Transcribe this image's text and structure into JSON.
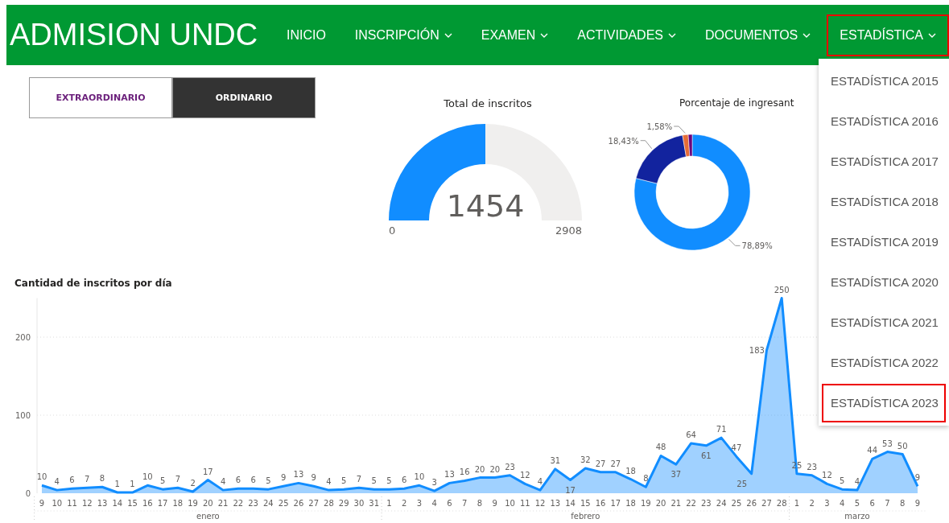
{
  "navbar": {
    "brand": "ADMISION UNDC",
    "items": [
      {
        "label": "INICIO",
        "has_menu": false,
        "highlighted": false
      },
      {
        "label": "INSCRIPCIÓN",
        "has_menu": true,
        "highlighted": false
      },
      {
        "label": "EXAMEN",
        "has_menu": true,
        "highlighted": false
      },
      {
        "label": "ACTIVIDADES",
        "has_menu": true,
        "highlighted": false
      },
      {
        "label": "DOCUMENTOS",
        "has_menu": true,
        "highlighted": false
      },
      {
        "label": "ESTADÍSTICA",
        "has_menu": true,
        "highlighted": true
      }
    ]
  },
  "dropdown": {
    "items": [
      {
        "label": "ESTADÍSTICA 2015",
        "highlighted": false
      },
      {
        "label": "ESTADÍSTICA 2016",
        "highlighted": false
      },
      {
        "label": "ESTADÍSTICA 2017",
        "highlighted": false
      },
      {
        "label": "ESTADÍSTICA 2018",
        "highlighted": false
      },
      {
        "label": "ESTADÍSTICA 2019",
        "highlighted": false
      },
      {
        "label": "ESTADÍSTICA 2020",
        "highlighted": false
      },
      {
        "label": "ESTADÍSTICA 2021",
        "highlighted": false
      },
      {
        "label": "ESTADÍSTICA 2022",
        "highlighted": false
      },
      {
        "label": "ESTADÍSTICA 2023",
        "highlighted": true
      }
    ]
  },
  "toggle": [
    {
      "label": "EXTRAORDINARIO",
      "selected": false
    },
    {
      "label": "ORDINARIO",
      "selected": true
    }
  ],
  "gauge": {
    "title": "Total de inscritos",
    "value": "1454",
    "min": "0",
    "max": "2908"
  },
  "donut": {
    "title": "Porcentaje de ingresant",
    "chart_data": {
      "type": "donut",
      "values": [
        78.89,
        18.43,
        1.58,
        1.1
      ],
      "colors": [
        "#118dff",
        "#12239e",
        "#e66c37",
        "#6b007b"
      ],
      "value_labels": [
        "78,89%",
        "18,43%",
        "1,58%",
        null
      ]
    }
  },
  "daily": {
    "title": "Cantidad de inscritos por día",
    "months": [
      {
        "label": "enero",
        "days": [
          "9",
          "10",
          "11",
          "12",
          "13",
          "14",
          "15",
          "16",
          "17",
          "18",
          "19",
          "20",
          "21",
          "22",
          "23",
          "24",
          "25",
          "26",
          "27",
          "28",
          "29",
          "30",
          "31"
        ]
      },
      {
        "label": "febrero",
        "days": [
          "1",
          "2",
          "3",
          "4",
          "6",
          "7",
          "8",
          "9",
          "10",
          "11",
          "12",
          "13",
          "14",
          "15",
          "16",
          "17",
          "18",
          "19",
          "20",
          "21",
          "22",
          "23",
          "24",
          "25",
          "26",
          "27",
          "28"
        ]
      },
      {
        "label": "marzo",
        "days": [
          "1",
          "2",
          "3",
          "4",
          "5",
          "6",
          "7",
          "8",
          "9"
        ]
      }
    ],
    "chart_data": {
      "type": "area",
      "ylim": [
        0,
        250
      ],
      "yticks": [
        0,
        100,
        200
      ],
      "data_labels": true,
      "series": [
        {
          "color": "#118dff",
          "values": [
            10,
            4,
            6,
            7,
            8,
            1,
            1,
            10,
            5,
            7,
            2,
            17,
            4,
            6,
            6,
            5,
            9,
            13,
            9,
            4,
            5,
            7,
            5,
            5,
            6,
            10,
            3,
            13,
            16,
            20,
            20,
            23,
            12,
            4,
            31,
            17,
            32,
            27,
            27,
            18,
            8,
            48,
            37,
            64,
            61,
            71,
            47,
            25,
            183,
            250,
            25,
            23,
            12,
            5,
            4,
            44,
            53,
            50,
            9
          ]
        }
      ]
    }
  }
}
